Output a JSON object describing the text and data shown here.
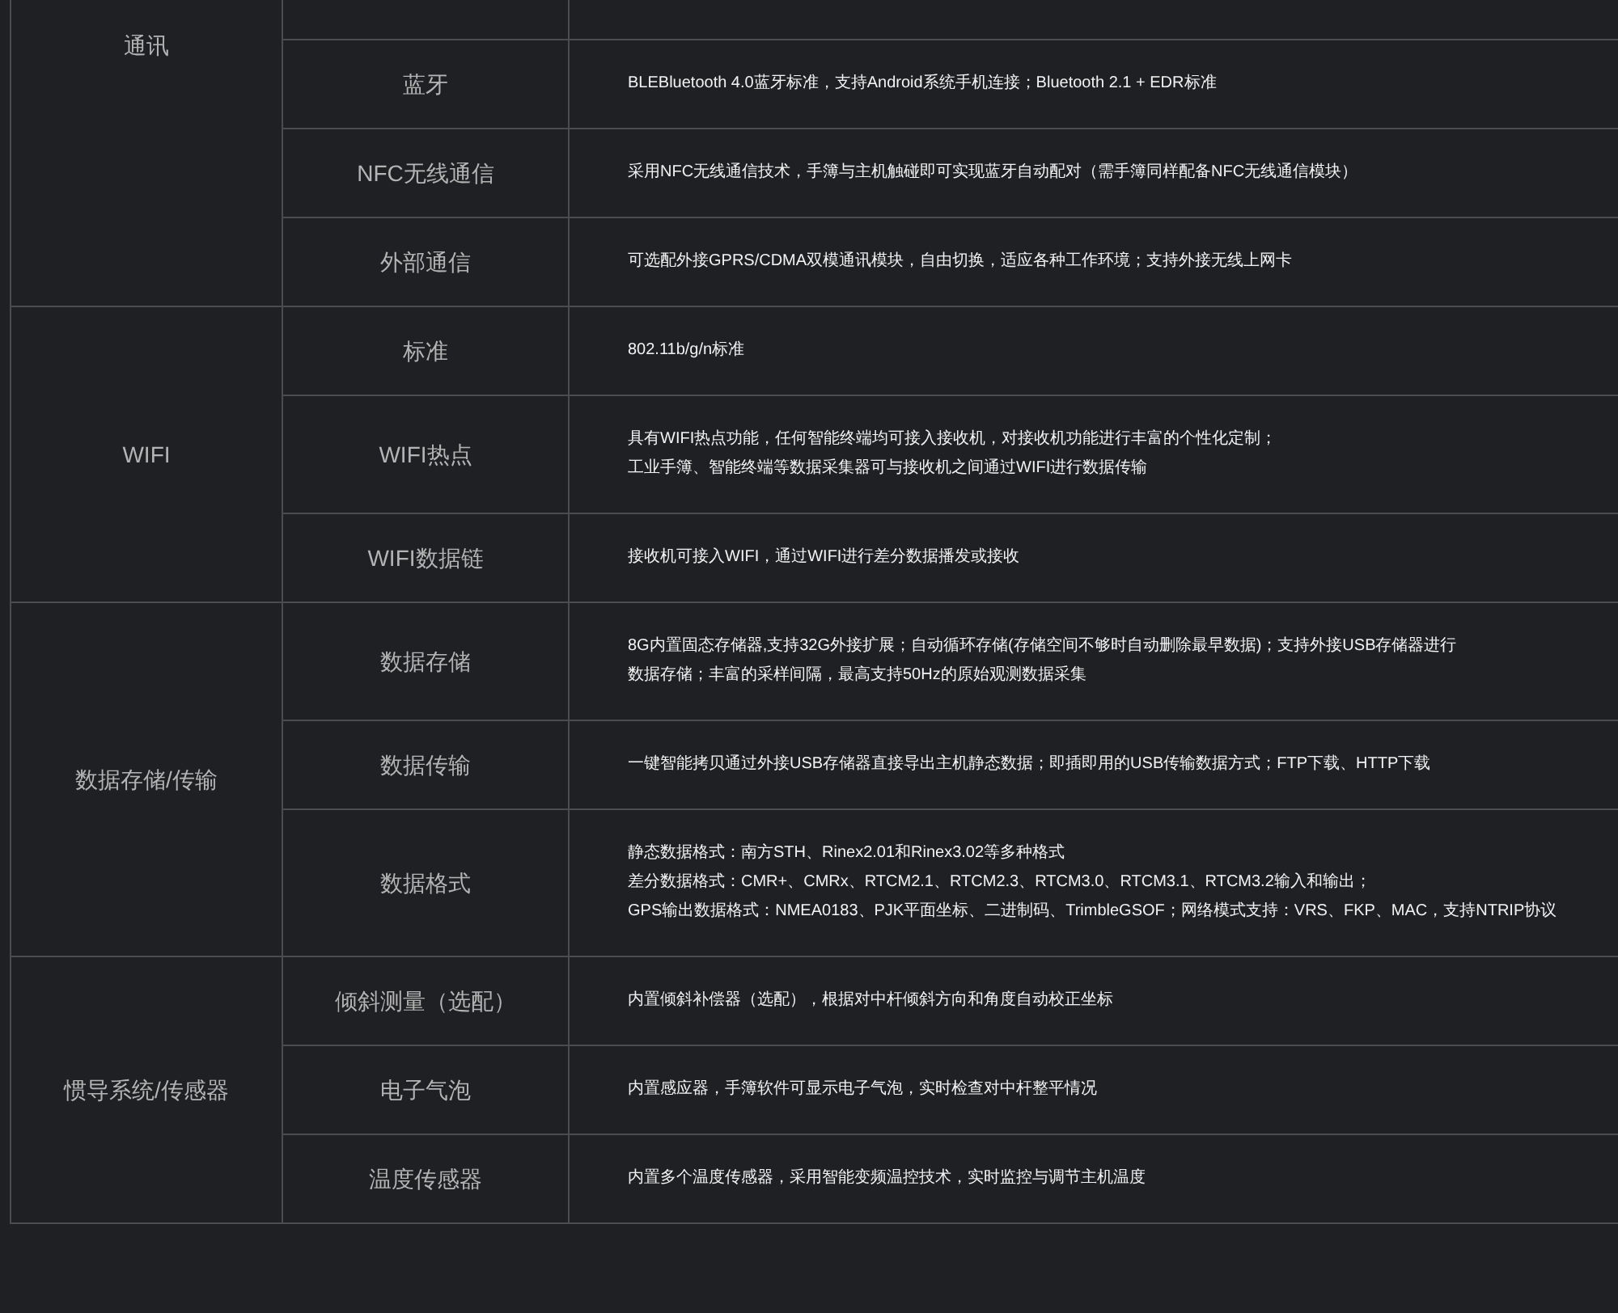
{
  "groups": [
    {
      "category": "通讯",
      "items": [
        {
          "kind": "clipped"
        },
        {
          "kind": "row",
          "name": "蓝牙",
          "lines": [
            "BLEBluetooth 4.0蓝牙标准，支持Android系统手机连接；Bluetooth 2.1 + EDR标准"
          ]
        },
        {
          "kind": "row",
          "name": "NFC无线通信",
          "lines": [
            "采用NFC无线通信技术，手簿与主机触碰即可实现蓝牙自动配对（需手簿同样配备NFC无线通信模块）"
          ]
        },
        {
          "kind": "row",
          "name": "外部通信",
          "lines": [
            "可选配外接GPRS/CDMA双模通讯模块，自由切换，适应各种工作环境；支持外接无线上网卡"
          ]
        }
      ]
    },
    {
      "category": "WIFI",
      "items": [
        {
          "kind": "row",
          "name": "标准",
          "lines": [
            "802.11b/g/n标准"
          ]
        },
        {
          "kind": "row",
          "name": "WIFI热点",
          "lines": [
            "具有WIFI热点功能，任何智能终端均可接入接收机，对接收机功能进行丰富的个性化定制；",
            "工业手簿、智能终端等数据采集器可与接收机之间通过WIFI进行数据传输"
          ]
        },
        {
          "kind": "row",
          "name": "WIFI数据链",
          "lines": [
            "接收机可接入WIFI，通过WIFI进行差分数据播发或接收"
          ]
        }
      ]
    },
    {
      "category": "数据存储/传输",
      "items": [
        {
          "kind": "row",
          "name": "数据存储",
          "lines": [
            "8G内置固态存储器,支持32G外接扩展；自动循环存储(存储空间不够时自动删除最早数据)；支持外接USB存储器进行",
            "数据存储；丰富的采样间隔，最高支持50Hz的原始观测数据采集"
          ]
        },
        {
          "kind": "row",
          "name": "数据传输",
          "lines": [
            "一键智能拷贝通过外接USB存储器直接导出主机静态数据；即插即用的USB传输数据方式；FTP下载、HTTP下载"
          ]
        },
        {
          "kind": "row",
          "name": "数据格式",
          "lines": [
            "静态数据格式：南方STH、Rinex2.01和Rinex3.02等多种格式",
            "差分数据格式：CMR+、CMRx、RTCM2.1、RTCM2.3、RTCM3.0、RTCM3.1、RTCM3.2输入和输出；",
            "GPS输出数据格式：NMEA0183、PJK平面坐标、二进制码、TrimbleGSOF；网络模式支持：VRS、FKP、MAC，支持NTRIP协议"
          ]
        }
      ]
    },
    {
      "category": "惯导系统/传感器",
      "items": [
        {
          "kind": "row",
          "name": "倾斜测量（选配）",
          "lines": [
            "内置倾斜补偿器（选配），根据对中杆倾斜方向和角度自动校正坐标"
          ]
        },
        {
          "kind": "row",
          "name": "电子气泡",
          "lines": [
            "内置感应器，手簿软件可显示电子气泡，实时检查对中杆整平情况"
          ]
        },
        {
          "kind": "row",
          "name": "温度传感器",
          "lines": [
            "内置多个温度传感器，采用智能变频温控技术，实时监控与调节主机温度"
          ]
        }
      ]
    }
  ]
}
